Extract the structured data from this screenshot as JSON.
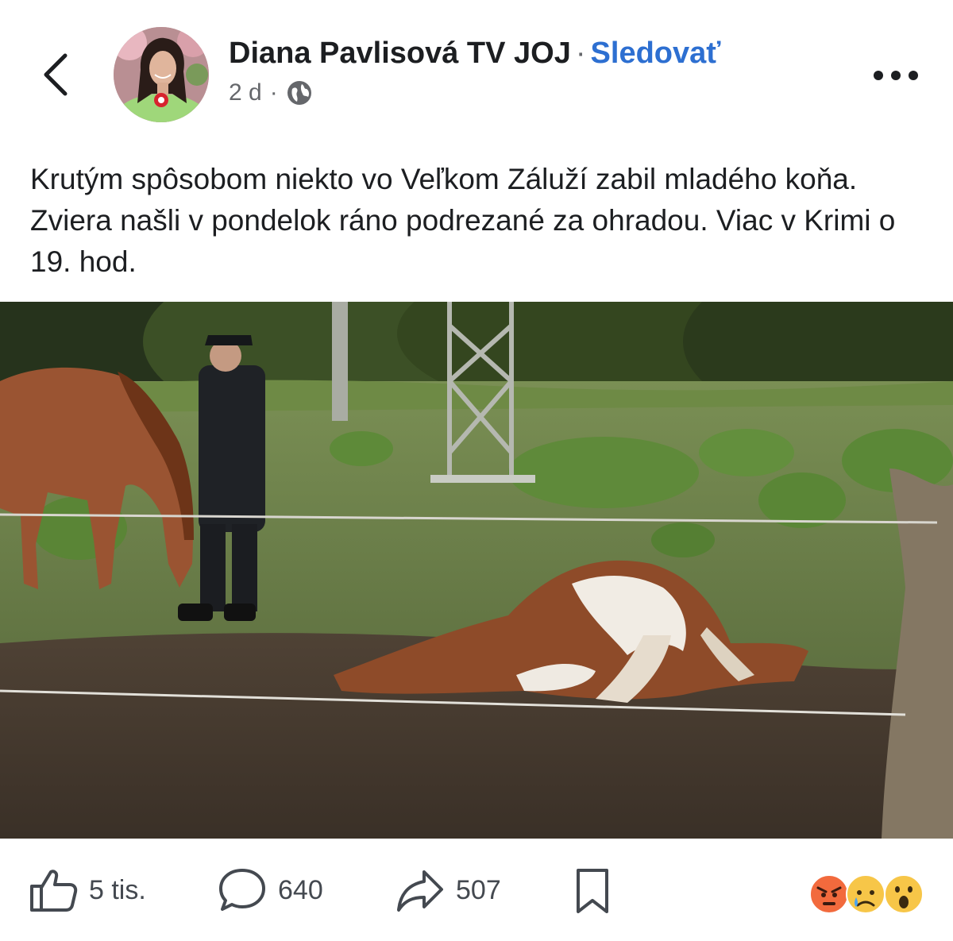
{
  "header": {
    "author_name": "Diana Pavlisová TV JOJ",
    "separator": "·",
    "follow_label": "Sledovať",
    "timestamp": "2 d",
    "meta_separator": "·",
    "audience_icon": "globe-icon",
    "back_icon": "chevron-left-icon",
    "more_icon": "more-horizontal-icon"
  },
  "post": {
    "text": "Krutým spôsobom niekto vo Veľkom Záluží zabil mladého koňa. Zviera našli v pondelok ráno podrezané za ohradou. Viac v Krimi o 19. hod."
  },
  "actions": {
    "like_count": "5 tis.",
    "comment_count": "640",
    "share_count": "507",
    "like_icon": "thumbs-up-icon",
    "comment_icon": "comment-bubble-icon",
    "share_icon": "share-arrow-icon",
    "save_icon": "bookmark-icon"
  },
  "reactions": [
    "angry-emoji",
    "sad-emoji",
    "wow-emoji"
  ],
  "colors": {
    "accent": "#2d6fd1",
    "text_primary": "#1c1e21",
    "text_secondary": "#65676b"
  }
}
